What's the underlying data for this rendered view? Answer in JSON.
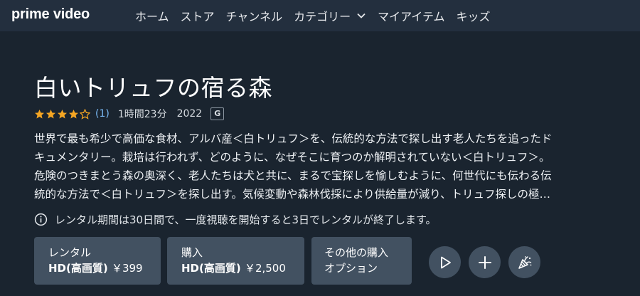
{
  "header": {
    "logo": "prime video",
    "nav": [
      {
        "label": "ホーム"
      },
      {
        "label": "ストア"
      },
      {
        "label": "チャンネル"
      },
      {
        "label": "カテゴリー",
        "has_dropdown": true
      },
      {
        "label": "マイアイテム"
      },
      {
        "label": "キッズ"
      }
    ]
  },
  "title": "白いトリュフの宿る森",
  "meta": {
    "rating_stars": 4,
    "rating_max": 5,
    "rating_count": "(1)",
    "duration": "1時間23分",
    "year": "2022",
    "maturity_badge": "G"
  },
  "synopsis": [
    "世界で最も希少で高価な食材、アルバ産＜白トリュフ＞を、伝統的な方法で探し出す老人たちを追ったド",
    "キュメンタリー。栽培は行われず、どのように、なぜそこに育つのか解明されていない＜白トリュフ＞。",
    "危険のつきまとう森の奥深く、老人たちは犬と共に、まるで宝探しを愉しむように、何世代にも伝わる伝",
    "統的な方法で＜白トリュフ＞を探し出す。気候変動や森林伐採により供給量が減り、トリュフ探しの極…"
  ],
  "notice": "レンタル期間は30日間で、一度視聴を開始すると3日でレンタルが終了します。",
  "buttons": {
    "rent": {
      "line1": "レンタル",
      "quality": "HD(高画質)",
      "price": "￥399"
    },
    "buy": {
      "line1": "購入",
      "quality": "HD(高画質)",
      "price": "￥2,500"
    },
    "other": {
      "line1": "その他の購入",
      "line2": "オプション"
    }
  },
  "colors": {
    "background": "#1a242f",
    "nav_background": "#232f3e",
    "button_background": "#425161",
    "star": "#f5a623",
    "rating_link": "#79b8f3"
  },
  "icons": [
    "info-icon",
    "play-icon",
    "plus-icon",
    "party-popper-icon",
    "chevron-down-icon",
    "star-icon"
  ]
}
